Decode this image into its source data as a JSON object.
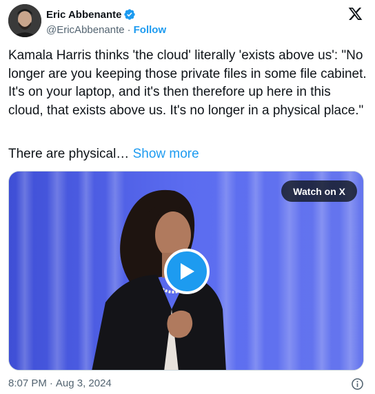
{
  "author": {
    "display_name": "Eric Abbenante",
    "handle": "@EricAbbenante",
    "separator": "·",
    "follow_label": "Follow"
  },
  "tweet": {
    "text": "Kamala Harris thinks 'the cloud' literally 'exists above us': \"No longer are you keeping those private files in some file cabinet. It's on your laptop, and it's then therefore up here in this cloud, that exists above us. It's no longer in a physical place.\"",
    "truncated_text": "There are physical…",
    "show_more_label": "Show more"
  },
  "media": {
    "watch_label": "Watch on X"
  },
  "meta": {
    "time": "8:07 PM",
    "separator": "·",
    "date": "Aug 3, 2024"
  },
  "icons": {
    "verified": "verified-badge-icon",
    "brand": "x-logo-icon",
    "play": "play-icon",
    "info": "info-icon"
  },
  "colors": {
    "accent": "#1d9bf0",
    "text": "#0f1419",
    "secondary": "#536471",
    "video_background": "#4a58d8"
  }
}
